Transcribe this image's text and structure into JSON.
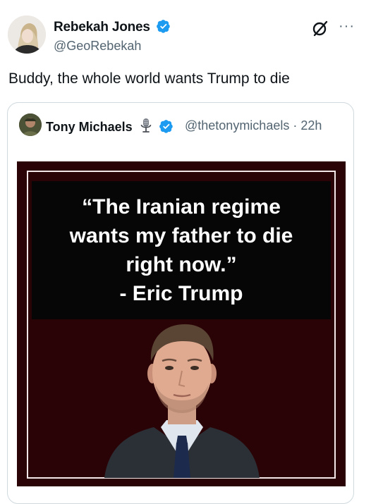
{
  "post": {
    "author_name": "Rebekah Jones",
    "handle": "@GeoRebekah",
    "text": "Buddy, the whole world wants Trump to die",
    "more_label": "···"
  },
  "quote": {
    "author_name": "Tony Michaels",
    "handle_time": "@thetonymichaels · 22h",
    "image": {
      "quote_lines": [
        "“The Iranian regime",
        "wants my father to die",
        "right now.”",
        "- Eric Trump"
      ]
    }
  },
  "colors": {
    "verified": "#1d9bf0",
    "secondary_text": "#536471",
    "card_border": "#cfd9de",
    "image_bg": "#2a0306",
    "quote_box": "#060606"
  },
  "icons": {
    "verified": "verified-badge-icon",
    "grok": "grok-icon",
    "more": "more-options-icon",
    "microphone": "microphone-icon"
  }
}
